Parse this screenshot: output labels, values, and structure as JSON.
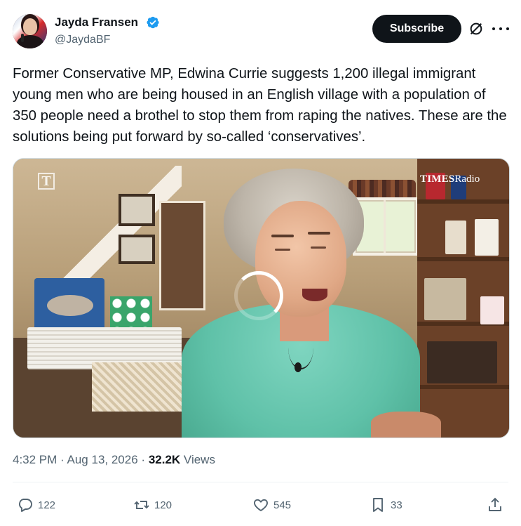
{
  "author": {
    "name": "Jayda Fransen",
    "handle": "@JaydaBF",
    "verified": true,
    "verified_color": "#1d9bf0"
  },
  "header_actions": {
    "subscribe_label": "Subscribe",
    "grok_icon": "grok-icon",
    "more_icon": "more-options-icon"
  },
  "tweet": {
    "text": "Former Conservative MP, Edwina Currie suggests 1,200 illegal immigrant young men who are being housed in an English village with a population of 350 people need a brothel to stop them from raping the natives. These are the solutions being put forward by so-called ‘conservatives’."
  },
  "media": {
    "corner_logo": "T",
    "brand_bold": "TIMES",
    "brand_regular": "Radio",
    "loading_icon": "loading-spinner-icon"
  },
  "meta": {
    "time": "4:32 PM",
    "separator": "·",
    "date": "Aug 13, 2026",
    "views_count": "32.2K",
    "views_label": "Views"
  },
  "actions": {
    "replies": "122",
    "reposts": "120",
    "likes": "545",
    "bookmarks": "33"
  },
  "colors": {
    "text": "#0f1419",
    "secondary": "#536471",
    "subscribe_bg": "#0f1419"
  }
}
